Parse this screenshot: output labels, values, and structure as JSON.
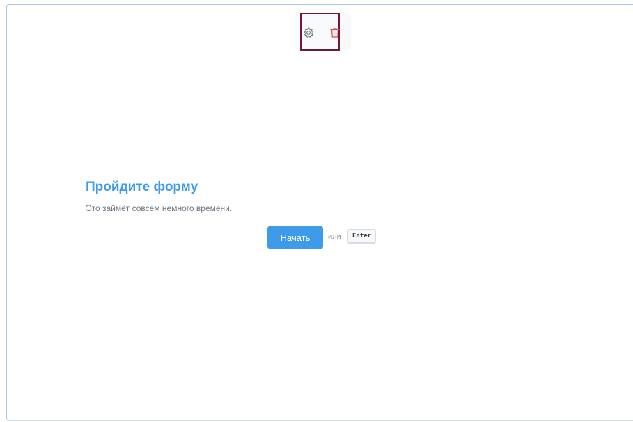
{
  "toolbar": {
    "icons": [
      "gear-icon",
      "trash-icon"
    ],
    "highlight_color": "#6b1a3a"
  },
  "form": {
    "title": "Пройдите форму",
    "subtitle": "Это займёт совсем немного времени.",
    "start_label": "Начать",
    "or_label": "или",
    "enter_key": "Enter"
  },
  "colors": {
    "accent": "#3d9be9",
    "danger": "#e0454b",
    "muted_text": "#6f7780"
  }
}
